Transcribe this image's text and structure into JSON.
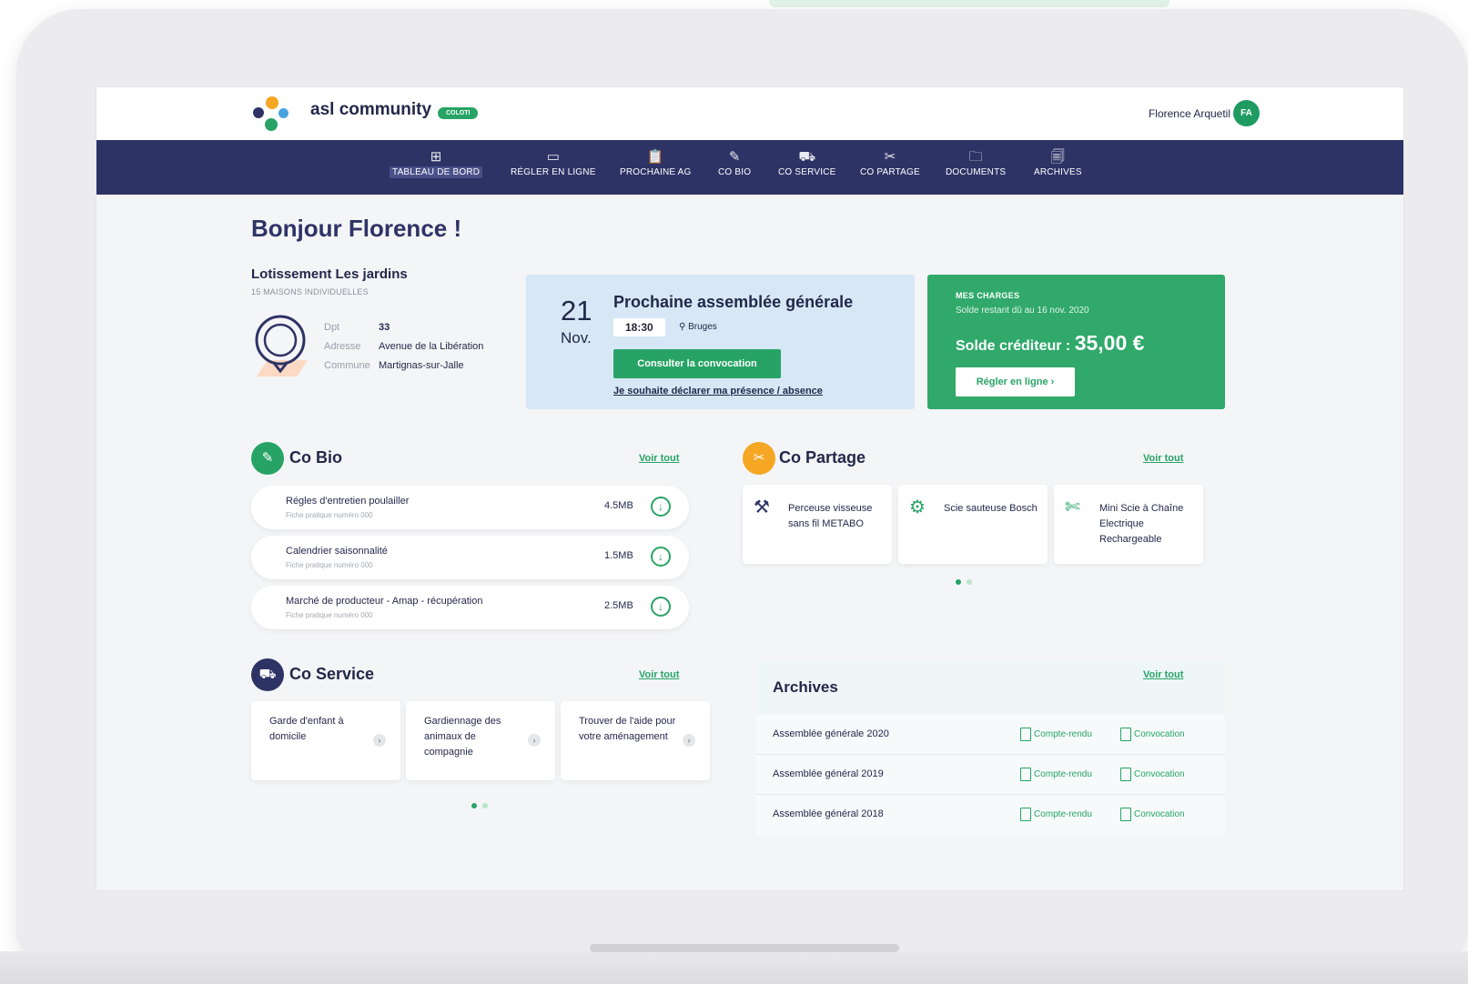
{
  "header": {
    "brand": "asl community",
    "badge": "COLOTI",
    "user_name": "Florence Arquetil",
    "user_initials": "FA"
  },
  "nav": [
    {
      "label": "TABLEAU DE BORD",
      "icon": "dashboard-icon",
      "glyph": "⊞",
      "active": true
    },
    {
      "label": "RÉGLER EN LIGNE",
      "icon": "card-icon",
      "glyph": "▭"
    },
    {
      "label": "PROCHAINE AG",
      "icon": "clipboard-icon",
      "glyph": "📋"
    },
    {
      "label": "CO BIO",
      "icon": "leaf-icon",
      "glyph": "✎"
    },
    {
      "label": "CO SERVICE",
      "icon": "car-icon",
      "glyph": "⛟"
    },
    {
      "label": "CO PARTAGE",
      "icon": "tools-icon",
      "glyph": "✂"
    },
    {
      "label": "DOCUMENTS",
      "icon": "folder-icon",
      "glyph": "🗀"
    },
    {
      "label": "ARCHIVES",
      "icon": "archive-icon",
      "glyph": "🗐"
    }
  ],
  "greeting": "Bonjour Florence !",
  "lotissement": {
    "title": "Lotissement Les jardins",
    "subtitle": "15 MAISONS INDIVIDUELLES",
    "rows": [
      {
        "key": "Dpt",
        "value": "33"
      },
      {
        "key": "Adresse",
        "value": "Avenue de la Libération"
      },
      {
        "key": "Commune",
        "value": "Martignas-sur-Jalle"
      }
    ]
  },
  "ag": {
    "day": "21",
    "month": "Nov.",
    "title": "Prochaine assemblée générale",
    "time": "18:30",
    "place": "Bruges",
    "button": "Consulter la convocation",
    "link": "Je souhaite déclarer ma présence / absence"
  },
  "charges": {
    "title": "MES CHARGES",
    "subtitle": "Solde restant dû au 16 nov. 2020",
    "balance_label": "Solde créditeur :",
    "balance_value": "35,00 €",
    "button": "Régler en ligne",
    "color": "#30a96b"
  },
  "co_bio": {
    "title": "Co Bio",
    "voir": "Voir tout",
    "items": [
      {
        "title": "Régles d'entretien poulailler",
        "sub": "Fiche pratique numéro 000",
        "size": "4.5MB"
      },
      {
        "title": "Calendrier saisonnalité",
        "sub": "Fiche pratique numéro 000",
        "size": "1.5MB"
      },
      {
        "title": "Marché de producteur - Amap - récupération",
        "sub": "Fiche pratique numéro 000",
        "size": "2.5MB"
      }
    ]
  },
  "co_partage": {
    "title": "Co Partage",
    "voir": "Voir tout",
    "items": [
      {
        "title": "Perceuse visseuse sans fil METABO"
      },
      {
        "title": "Scie sauteuse Bosch"
      },
      {
        "title": "Mini Scie à Chaîne Electrique Rechargeable"
      }
    ]
  },
  "co_service": {
    "title": "Co Service",
    "voir": "Voir tout",
    "items": [
      {
        "title": "Garde d'enfant à domicile"
      },
      {
        "title": "Gardiennage des animaux de compagnie"
      },
      {
        "title": "Trouver de l'aide pour votre aménagement"
      }
    ]
  },
  "archives": {
    "title": "Archives",
    "voir": "Voir tout",
    "rows": [
      {
        "name": "Assemblée générale 2020",
        "doc1": "Compte-rendu",
        "doc2": "Convocation"
      },
      {
        "name": "Assemblée général 2019",
        "doc1": "Compte-rendu",
        "doc2": "Convocation"
      },
      {
        "name": "Assemblée général 2018",
        "doc1": "Compte-rendu",
        "doc2": "Convocation"
      }
    ]
  },
  "colors": {
    "navy": "#2e3366",
    "green": "#27a465",
    "orange": "#f5a623"
  }
}
